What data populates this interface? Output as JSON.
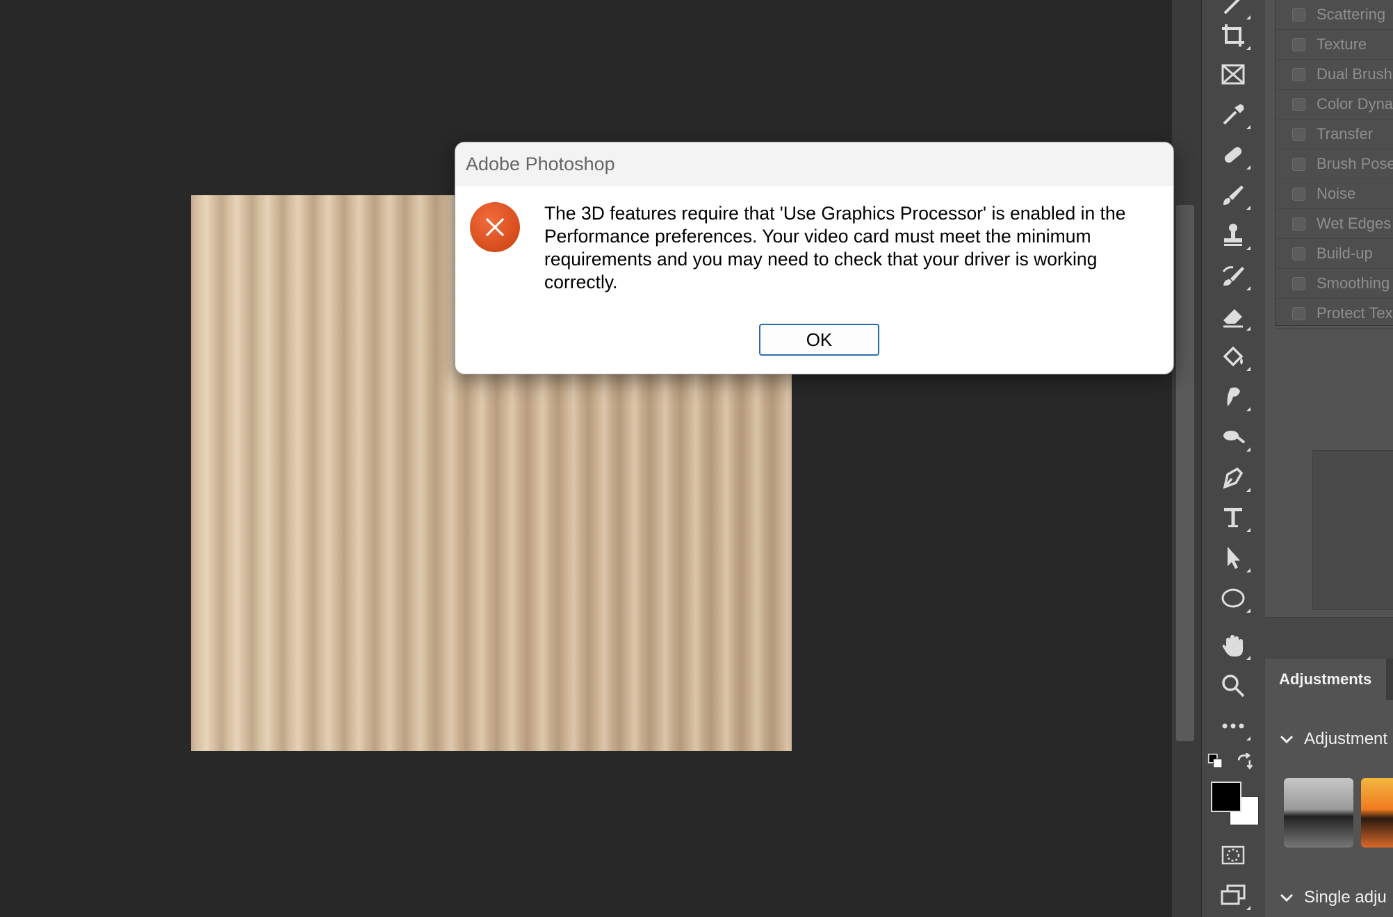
{
  "dialog": {
    "title": "Adobe Photoshop",
    "message": "The 3D features require that 'Use Graphics Processor' is enabled in the Performance preferences. Your video card must meet the minimum requirements and you may need to check that your driver is working correctly.",
    "ok_label": "OK",
    "icon": "error-icon",
    "accent_color": "#2b6cb0",
    "icon_color": "#e04e1a"
  },
  "toolbar": {
    "tools": [
      "brush-tool-icon",
      "crop-icon",
      "frame-icon",
      "eyedropper-icon",
      "healing-brush-icon",
      "brush-icon",
      "clone-stamp-icon",
      "history-brush-icon",
      "eraser-icon",
      "paint-bucket-icon",
      "smudge-icon",
      "dodge-icon",
      "pen-icon",
      "type-icon",
      "path-selection-icon",
      "ellipse-icon",
      "hand-icon",
      "zoom-icon",
      "more-tools-icon",
      "default-colors-icon",
      "swap-colors-icon",
      "foreground-color-swatch",
      "background-color-swatch",
      "quick-mask-icon",
      "screen-mode-icon"
    ],
    "foreground_color": "#000000",
    "background_color": "#ffffff"
  },
  "brush_settings": {
    "options": [
      "Scattering",
      "Texture",
      "Dual Brush",
      "Color Dynami",
      "Transfer",
      "Brush Pose",
      "Noise",
      "Wet Edges",
      "Build-up",
      "Smoothing",
      "Protect Textu"
    ]
  },
  "adjustments": {
    "tab_label": "Adjustments",
    "section1": "Adjustment",
    "section2": "Single adju"
  }
}
